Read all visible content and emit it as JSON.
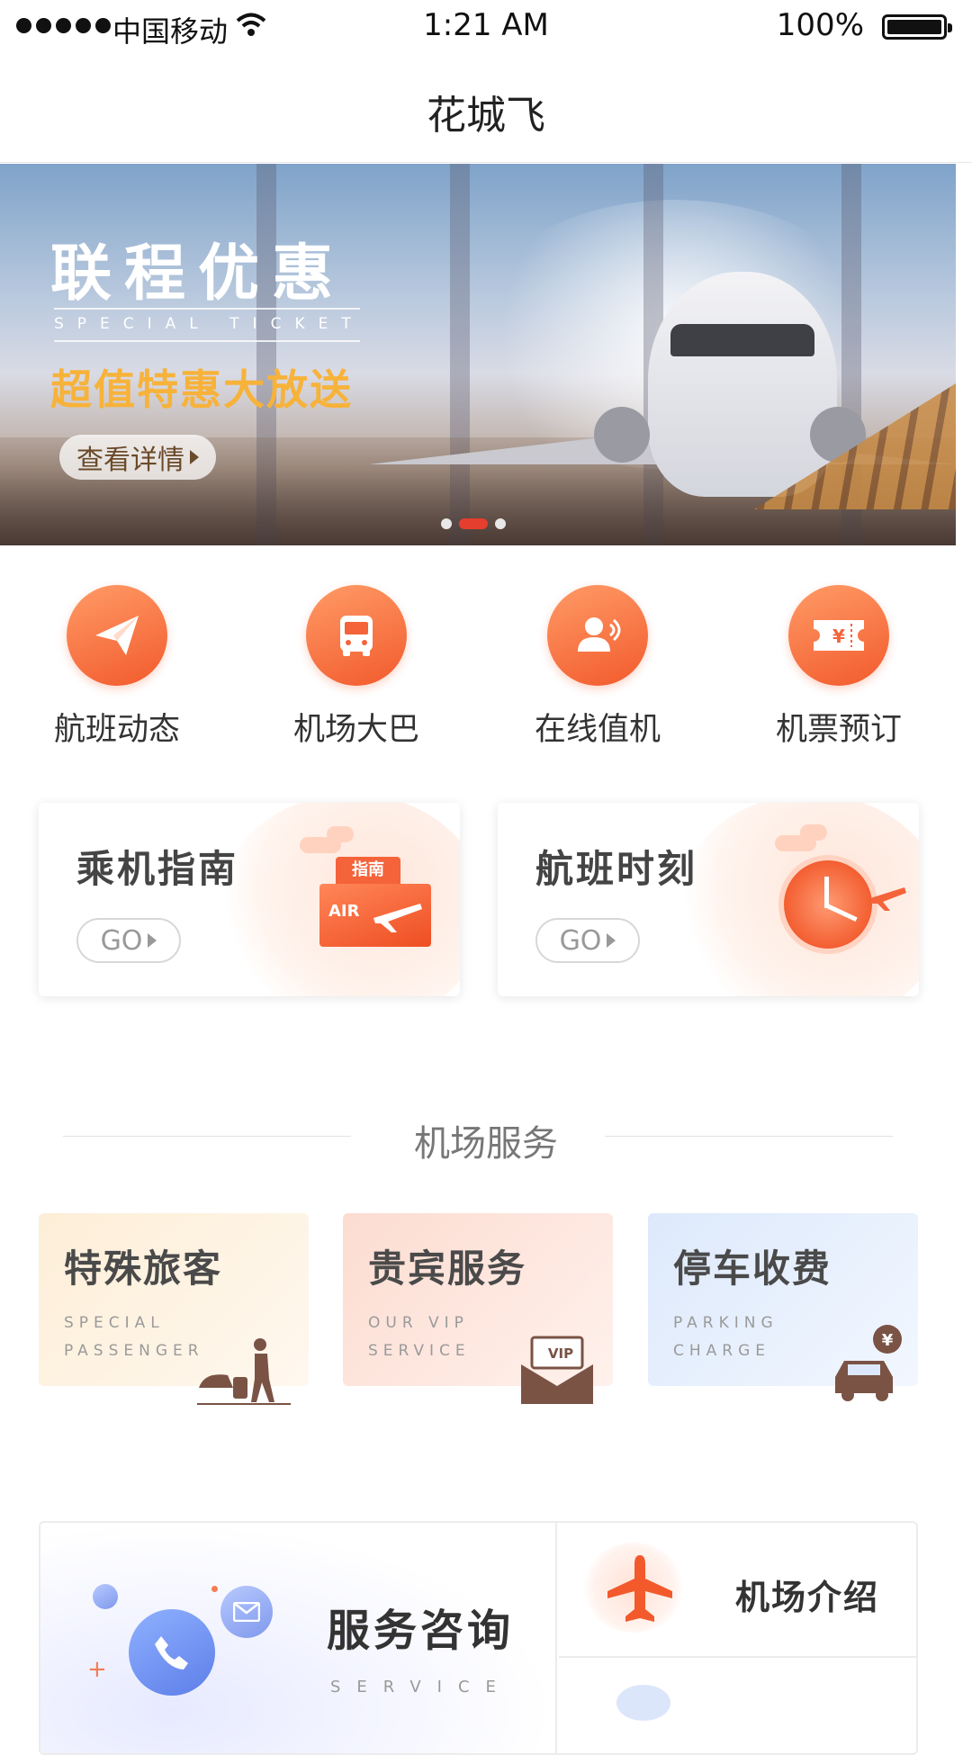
{
  "status_bar": {
    "carrier": "中国移动",
    "time": "1:21 AM",
    "battery": "100%",
    "icons": [
      "signal-icon",
      "wifi-icon",
      "battery-icon"
    ]
  },
  "nav": {
    "title": "花城飞"
  },
  "banner": {
    "title": "联程优惠",
    "subtitle_en": "SPECIAL TICKET",
    "subtitle": "超值特惠大放送",
    "button": "查看详情",
    "slide_count": 3,
    "active_slide": 2,
    "colors": {
      "accent": "#f7b23a",
      "dot_active": "#e53d2e"
    }
  },
  "quick_nav": [
    {
      "label": "航班动态",
      "icon": "paper-plane-icon"
    },
    {
      "label": "机场大巴",
      "icon": "bus-icon"
    },
    {
      "label": "在线值机",
      "icon": "user-checkin-icon"
    },
    {
      "label": "机票预订",
      "icon": "ticket-yen-icon"
    }
  ],
  "guide_cards": [
    {
      "title": "乘机指南",
      "button": "GO",
      "tag": "指南",
      "badge": "AIR",
      "icon": "air-ticket-icon"
    },
    {
      "title": "航班时刻",
      "button": "GO",
      "icon": "clock-plane-icon"
    }
  ],
  "section": {
    "title": "机场服务"
  },
  "services": [
    {
      "title": "特殊旅客",
      "en1": "SPECIAL",
      "en2": "PASSENGER",
      "icon": "traveler-luggage-icon",
      "bg": "#fdf2e2"
    },
    {
      "title": "贵宾服务",
      "en1": "OUR VIP",
      "en2": "SERVICE",
      "icon": "vip-envelope-icon",
      "bg": "#fde7e0",
      "tag": "VIP"
    },
    {
      "title": "停车收费",
      "en1": "PARKING",
      "en2": "CHARGE",
      "icon": "car-yen-icon",
      "bg": "#e9f1fd"
    }
  ],
  "bottom": {
    "consult_title": "服务咨询",
    "consult_en": "SERVICE",
    "airport_intro": "机场介绍"
  },
  "colors": {
    "primary": "#f25a2c",
    "text": "#333333"
  }
}
